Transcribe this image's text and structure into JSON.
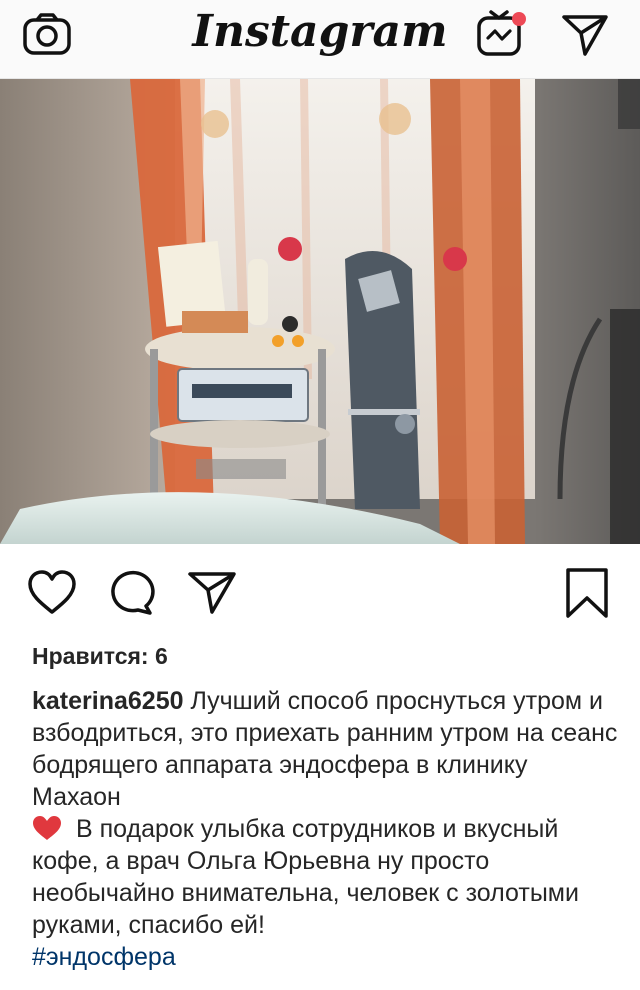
{
  "app": {
    "title": "Instagram"
  },
  "header": {
    "icons": [
      "camera-icon",
      "igtv-icon",
      "direct-send-icon"
    ],
    "igtv_notification_dot_color": "#ed4956"
  },
  "post": {
    "photo_description_icon": "photo",
    "actions": [
      "heart-icon",
      "comment-icon",
      "share-icon",
      "bookmark-icon"
    ],
    "likes_label": "Нравится: 6",
    "username": "katerina6250",
    "caption_part1": "Лучший способ проснуться утром и взбодриться, это приехать ранним утром на сеанс бодрящего аппарата эндосфера в клинику Махаон",
    "caption_part2": "В подарок улыбка сотрудников и вкусный кофе, а врач Ольга Юрьевна ну просто необычайно внимательна, человек с золотыми руками, спасибо ей!",
    "hashtag": "#эндосфера",
    "heart_emoji_color": "#e0383e",
    "hashtag_color": "#003569"
  }
}
